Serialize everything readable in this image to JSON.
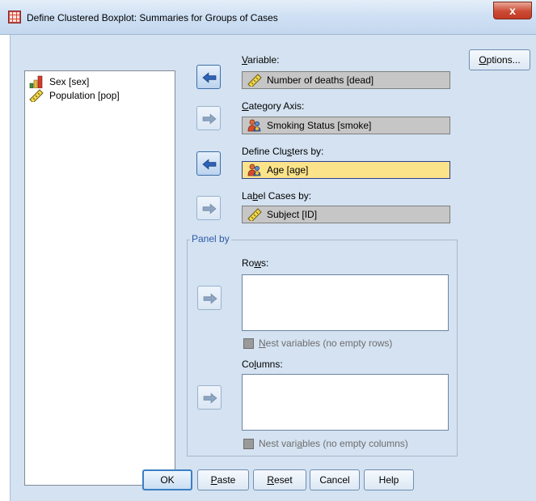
{
  "window": {
    "title": "Define Clustered Boxplot: Summaries for Groups of Cases",
    "close_label": "x"
  },
  "variable_list": [
    {
      "label": "Sex [sex]",
      "icon": "ordinal-bar-icon"
    },
    {
      "label": "Population [pop]",
      "icon": "scale-ruler-icon"
    }
  ],
  "fields": {
    "variable": {
      "label_pre": "",
      "label_u": "V",
      "label_post": "ariable:",
      "value": "Number of deaths [dead]",
      "icon": "scale-ruler-icon"
    },
    "category_axis": {
      "label_pre": "",
      "label_u": "C",
      "label_post": "ategory Axis:",
      "value": "Smoking Status [smoke]",
      "icon": "nominal-people-icon"
    },
    "define_clusters": {
      "label_pre": "Define Clu",
      "label_u": "s",
      "label_post": "ters by:",
      "value": "Age [age]",
      "icon": "nominal-people-icon"
    },
    "label_cases": {
      "label_pre": "La",
      "label_u": "b",
      "label_post": "el Cases by:",
      "value": "Subject [ID]",
      "icon": "scale-ruler-icon"
    }
  },
  "panel_by": {
    "legend": "Panel by",
    "rows": {
      "label_pre": "Ro",
      "label_u": "w",
      "label_post": "s:"
    },
    "nest_rows": {
      "label_pre": "",
      "label_u": "N",
      "label_post": "est variables (no empty rows)"
    },
    "columns": {
      "label_pre": "Co",
      "label_u": "l",
      "label_post": "umns:"
    },
    "nest_columns": {
      "label_pre": "Nest vari",
      "label_u": "a",
      "label_post": "bles (no empty columns)"
    }
  },
  "buttons": {
    "options": {
      "pre": "",
      "u": "O",
      "post": "ptions..."
    },
    "ok": {
      "pre": "OK",
      "u": "",
      "post": ""
    },
    "paste": {
      "pre": "",
      "u": "P",
      "post": "aste"
    },
    "reset": {
      "pre": "",
      "u": "R",
      "post": "eset"
    },
    "cancel": {
      "pre": "Cancel",
      "u": "",
      "post": ""
    },
    "help": {
      "pre": "Help",
      "u": "",
      "post": ""
    }
  },
  "colors": {
    "dialog_bg": "#d4e2f1",
    "focused_field": "#fbe38a",
    "disabled_field": "#c6c6c6",
    "close_button": "#cc4b35",
    "active_arrow": "#2f64b8",
    "inactive_arrow": "#8fa6c2"
  }
}
